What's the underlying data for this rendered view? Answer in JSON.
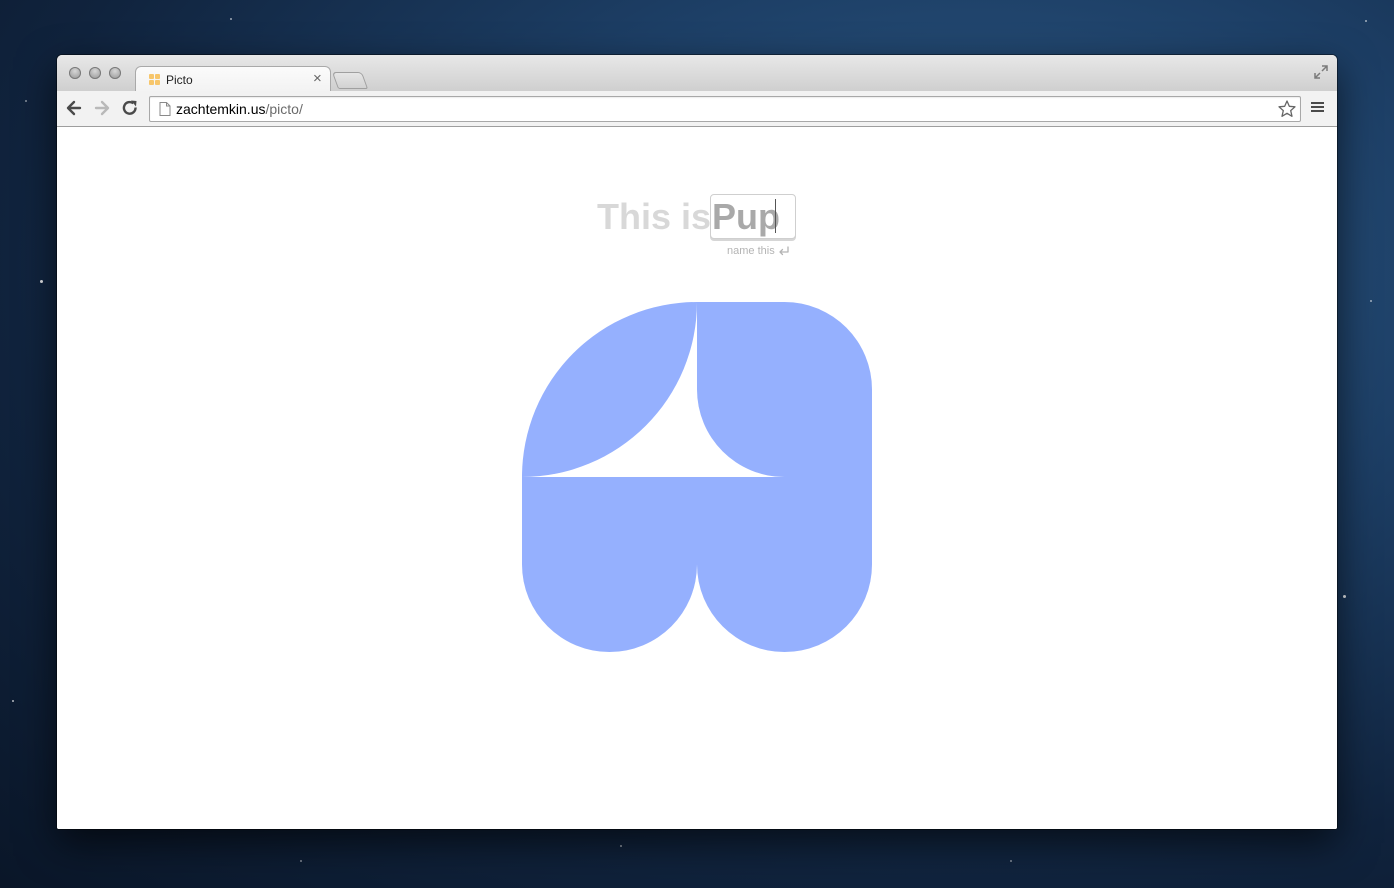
{
  "browser": {
    "tab": {
      "title": "Picto",
      "close_glyph": "×",
      "favicon_color": "#f7c66b"
    },
    "address": {
      "host": "zachtemkin.us",
      "path": "/picto/"
    },
    "icons": {
      "back": "back-arrow-icon",
      "forward": "forward-arrow-icon",
      "reload": "reload-icon",
      "page": "page-icon",
      "bookmark": "star-icon",
      "menu": "hamburger-menu-icon",
      "fullscreen": "fullscreen-icon"
    }
  },
  "page": {
    "heading_prefix": "This is",
    "name_value": "Pup",
    "hint": "name this",
    "hint_icon": "enter-icon",
    "picto_color": "#95b0fe",
    "text_color": "#d8d8d8"
  }
}
